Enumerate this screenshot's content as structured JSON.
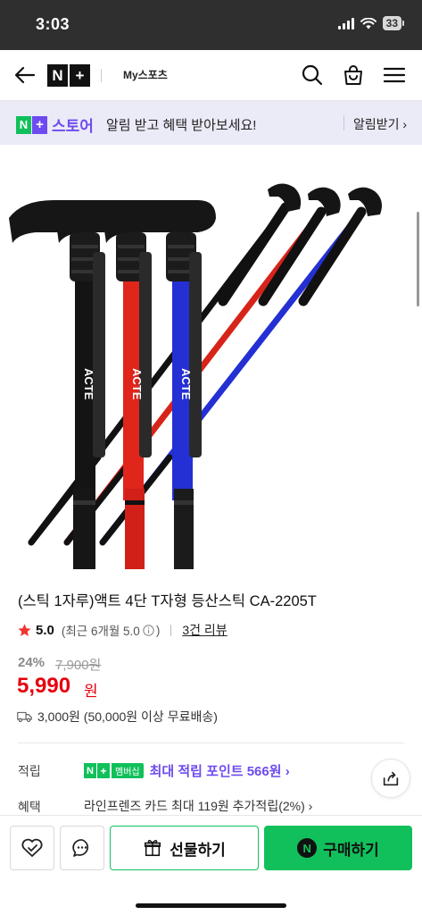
{
  "status_bar": {
    "time": "3:03",
    "battery": "33"
  },
  "header": {
    "brand_n": "N",
    "brand_plus": "+",
    "my_sports": "My스포츠"
  },
  "banner": {
    "logo_n": "N",
    "logo_plus": "+",
    "store_label": "스토어",
    "message": "알림 받고 혜택 받아보세요!",
    "cta": "알림받기 ›"
  },
  "product": {
    "title": "(스틱 1자루)액트 4단 T자형 등산스틱 CA-2205T",
    "rating": "5.0",
    "recent_rating": "(최근 6개월 5.0",
    "recent_close": ")",
    "review_count": "3건 리뷰",
    "discount_rate": "24%",
    "original_price": "7,900원",
    "sale_price": "5,990",
    "currency": "원",
    "shipping": "3,000원 (50,000원 이상 무료배송)",
    "image_brand": "ACTE",
    "pole_colors": [
      "#121212",
      "#e0251b",
      "#2430d4"
    ]
  },
  "points": {
    "label": "적립",
    "n": "N",
    "plus": "+",
    "membership": "멤버십",
    "text": "최대 적립 포인트 566원 ›"
  },
  "benefit": {
    "label": "혜택",
    "text": "라인프렌즈 카드 최대 119원 추가적립(2%) ›"
  },
  "actions": {
    "gift": "선물하기",
    "buy": "구매하기",
    "buy_n": "N"
  }
}
